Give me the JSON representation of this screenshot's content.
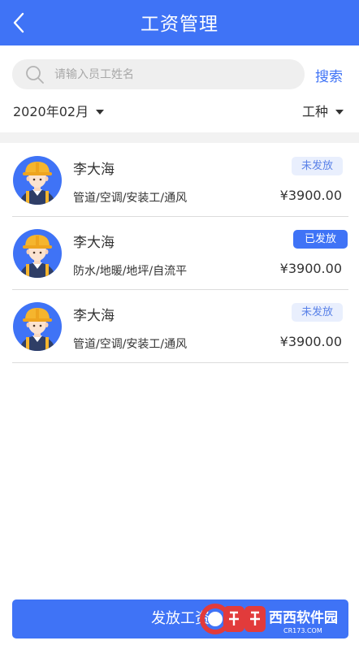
{
  "header": {
    "title": "工资管理",
    "back_icon": "chevron-left-icon"
  },
  "search": {
    "placeholder": "请输入员工姓名",
    "value": "",
    "button_label": "搜索",
    "icon": "search-icon"
  },
  "filters": {
    "month": "2020年02月",
    "trade_type": "工种"
  },
  "workers": [
    {
      "name": "李大海",
      "trades": "管道/空调/安装工/通风",
      "amount": "¥3900.00",
      "status": "未发放",
      "status_kind": "pending"
    },
    {
      "name": "李大海",
      "trades": "防水/地暖/地坪/自流平",
      "amount": "¥3900.00",
      "status": "已发放",
      "status_kind": "paid"
    },
    {
      "name": "李大海",
      "trades": "管道/空调/安装工/通风",
      "amount": "¥3900.00",
      "status": "未发放",
      "status_kind": "pending"
    }
  ],
  "footer": {
    "pay_button_label": "发放工资"
  },
  "watermark": {
    "brand": "西西软件园",
    "site": "CR173.COM"
  },
  "colors": {
    "primary": "#3f73f6",
    "badge_pending_bg": "#e9effd",
    "badge_pending_text": "#5a82e8",
    "hat": "#f5b52e",
    "shirt": "#2f3e66"
  }
}
